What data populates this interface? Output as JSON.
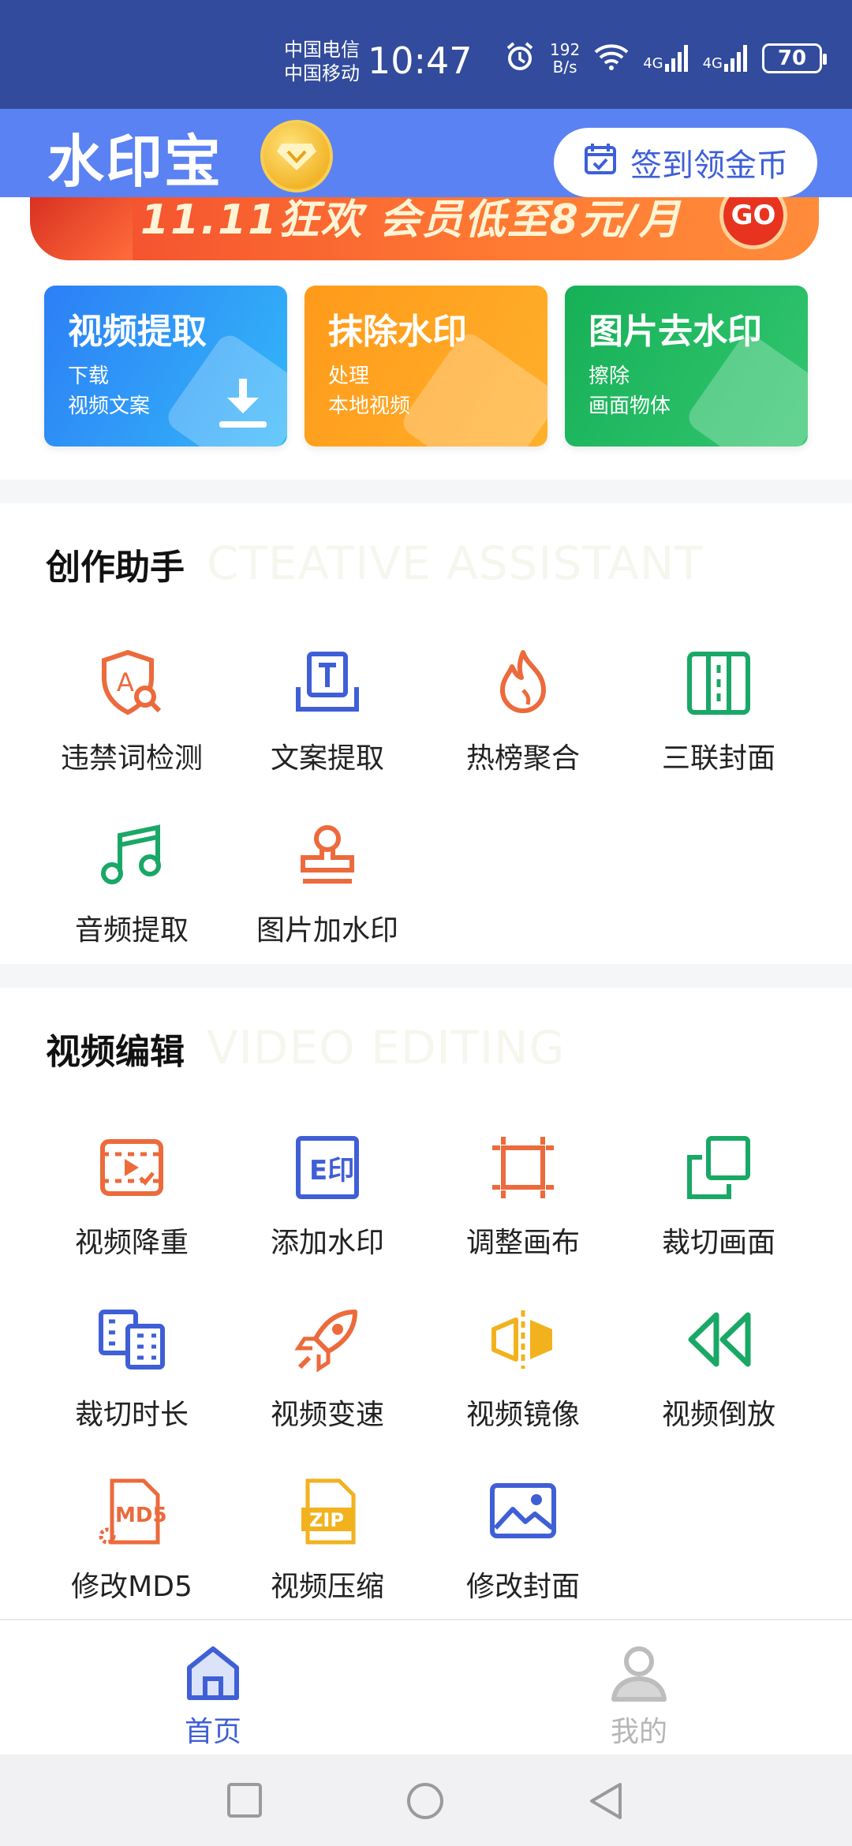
{
  "status_bar": {
    "carrier_1": "中国电信",
    "carrier_2": "中国移动",
    "time": "10:47",
    "net_speed_value": "192",
    "net_speed_unit": "B/s",
    "signal_1": "4G",
    "signal_2": "4G",
    "battery": "70"
  },
  "header": {
    "app_title": "水印宝",
    "checkin_label": "签到领金币"
  },
  "banner": {
    "text": "11.11狂欢 会员低至8元/月",
    "go_label": "GO"
  },
  "feature_cards": [
    {
      "title": "视频提取",
      "line1": "下载",
      "line2": "视频文案"
    },
    {
      "title": "抹除水印",
      "line1": "处理",
      "line2": "本地视频"
    },
    {
      "title": "图片去水印",
      "line1": "擦除",
      "line2": "画面物体"
    }
  ],
  "creative": {
    "title": "创作助手",
    "en_title": "CTEATIVE ASSISTANT",
    "tools": [
      {
        "label": "违禁词检测",
        "icon": "shield-search-icon"
      },
      {
        "label": "文案提取",
        "icon": "text-extract-icon"
      },
      {
        "label": "热榜聚合",
        "icon": "fire-icon"
      },
      {
        "label": "三联封面",
        "icon": "triple-cover-icon"
      },
      {
        "label": "音频提取",
        "icon": "music-note-icon"
      },
      {
        "label": "图片加水印",
        "icon": "stamp-icon"
      }
    ]
  },
  "video_edit": {
    "title": "视频编辑",
    "en_title": "VIDEO EDITING",
    "tools": [
      {
        "label": "视频降重",
        "icon": "video-dedup-icon"
      },
      {
        "label": "添加水印",
        "icon": "add-watermark-icon"
      },
      {
        "label": "调整画布",
        "icon": "crop-canvas-icon"
      },
      {
        "label": "裁切画面",
        "icon": "crop-frame-icon"
      },
      {
        "label": "裁切时长",
        "icon": "film-trim-icon"
      },
      {
        "label": "视频变速",
        "icon": "rocket-icon"
      },
      {
        "label": "视频镜像",
        "icon": "mirror-icon"
      },
      {
        "label": "视频倒放",
        "icon": "rewind-icon"
      },
      {
        "label": "修改MD5",
        "icon": "md5-file-icon"
      },
      {
        "label": "视频压缩",
        "icon": "zip-file-icon"
      },
      {
        "label": "修改封面",
        "icon": "image-icon"
      }
    ]
  },
  "bottom_nav": {
    "home_label": "首页",
    "mine_label": "我的"
  },
  "colors": {
    "status_bar": "#324b9c",
    "header": "#5b82f2",
    "accent": "#3f5fd6"
  }
}
